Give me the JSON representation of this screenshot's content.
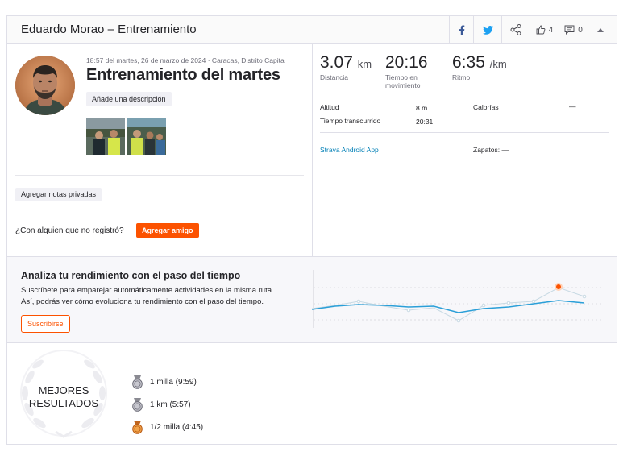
{
  "header": {
    "title": "Eduardo Morao – Entrenamiento",
    "kudos_count": "4",
    "comments_count": "0"
  },
  "activity": {
    "meta": "18:57 del martes, 26 de marzo de 2024 · Caracas, Distrito Capital",
    "title": "Entrenamiento del martes",
    "description_button": "Añade una descripción",
    "private_notes_button": "Agregar notas privadas",
    "missing_question": "¿Con alquien que no registró?",
    "add_friend_button": "Agregar amigo"
  },
  "stats": {
    "distance": {
      "value": "3.07",
      "unit": "km",
      "label": "Distancia"
    },
    "moving_time": {
      "value": "20:16",
      "label": "Tiempo en movimiento"
    },
    "pace": {
      "value": "6:35",
      "unit": "/km",
      "label": "Ritmo"
    }
  },
  "more_stats": {
    "elevation_label": "Altitud",
    "elevation_value": "8 m",
    "calories_label": "Calorías",
    "calories_value": "—",
    "elapsed_label": "Tiempo transcurrido",
    "elapsed_value": "20:31",
    "device": "Strava Android App",
    "shoes_label": "Zapatos:",
    "shoes_value": "—"
  },
  "analysis": {
    "title": "Analiza tu rendimiento con el paso del tiempo",
    "desc_line1": "Suscríbete para emparejar automáticamente actividades en la misma ruta.",
    "desc_line2": "Así, podrás ver cómo evoluciona tu rendimiento con el paso del tiempo.",
    "subscribe_button": "Suscribirse",
    "accent_color": "#fc5200",
    "line_color": "#2a9fd8"
  },
  "best_efforts": {
    "title_line1": "MEJORES",
    "title_line2": "RESULTADOS",
    "items": [
      {
        "label": "1 milla (9:59)",
        "medal": "silver"
      },
      {
        "label": "1 km (5:57)",
        "medal": "silver"
      },
      {
        "label": "1/2 milla (4:45)",
        "medal": "bronze"
      }
    ]
  }
}
